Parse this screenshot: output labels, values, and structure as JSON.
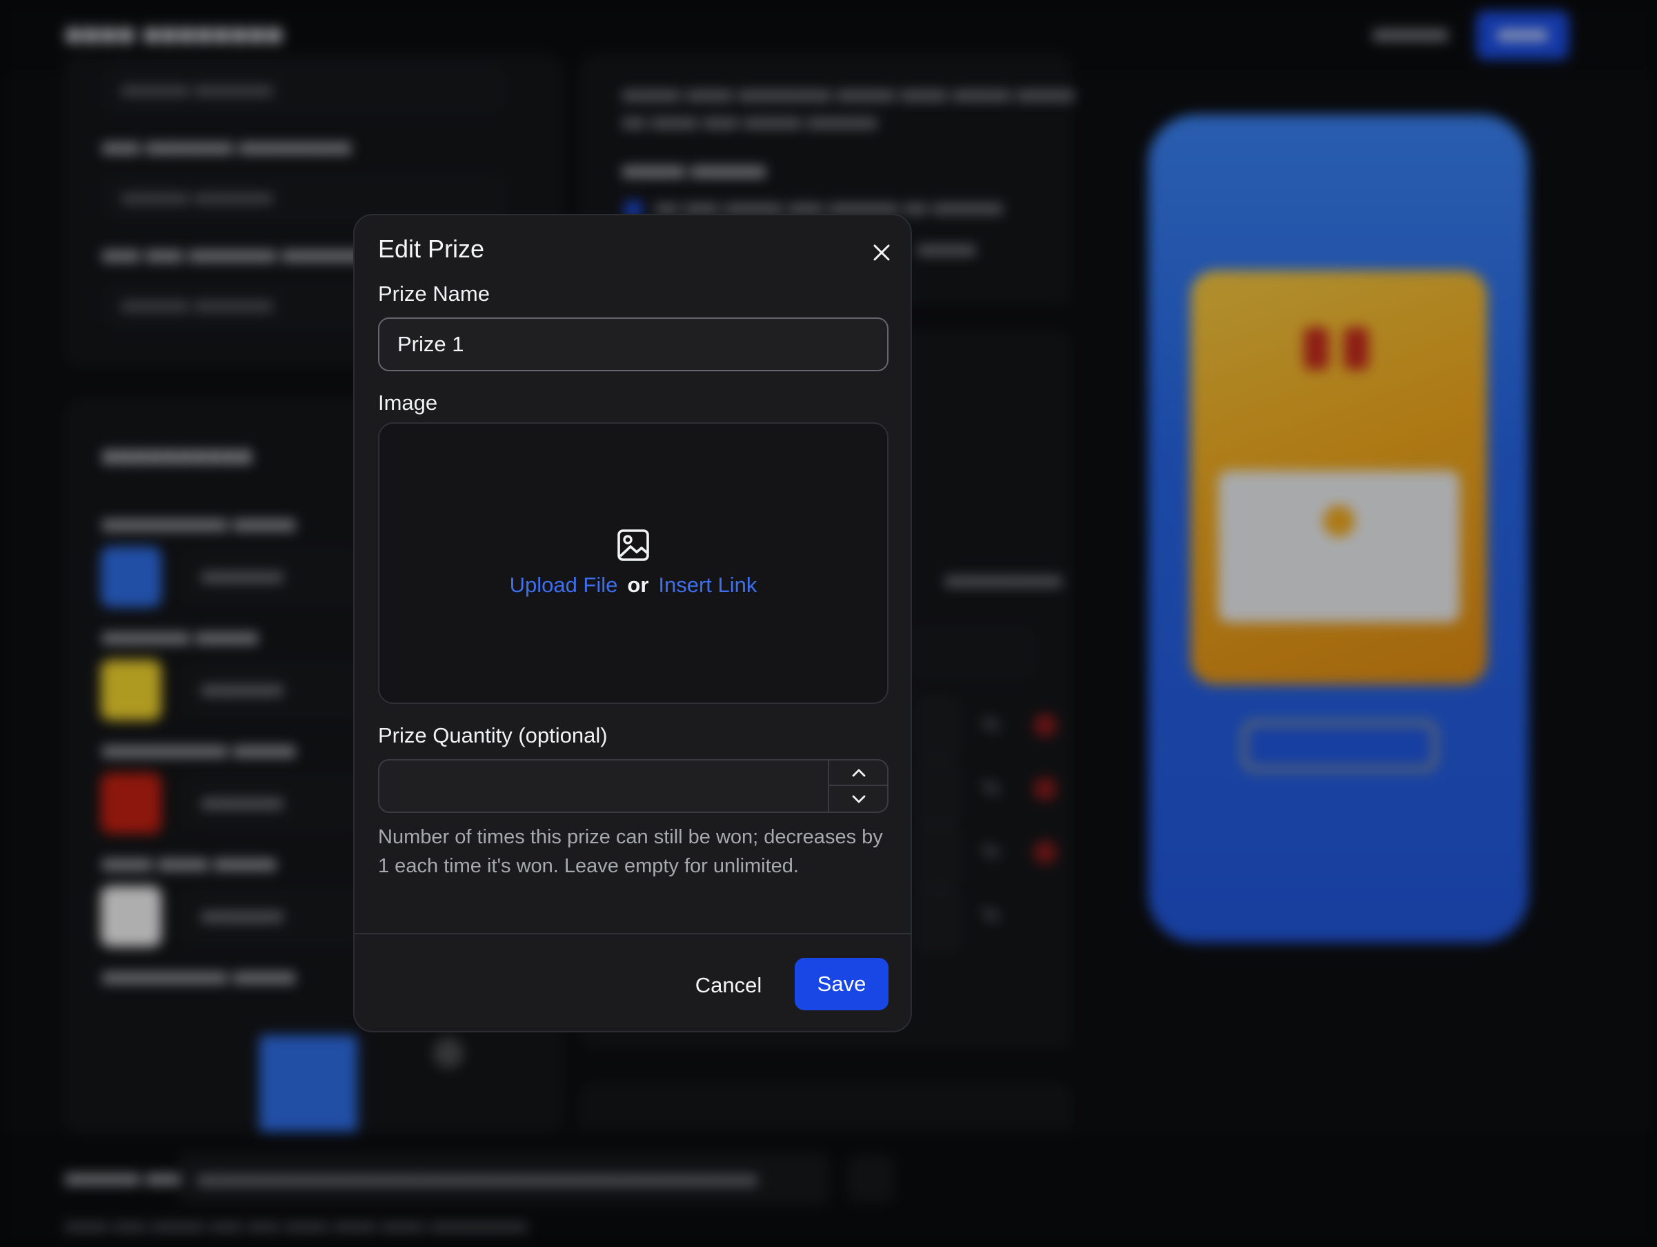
{
  "modal": {
    "title": "Edit Prize",
    "prize_name_label": "Prize Name",
    "prize_name_value": "Prize 1",
    "image_label": "Image",
    "upload_file_label": "Upload File",
    "or_label": "or",
    "insert_link_label": "Insert Link",
    "quantity_label": "Prize Quantity (optional)",
    "quantity_value": "",
    "quantity_help": "Number of times this prize can still be won; decreases by 1 each time it's won. Leave empty for unlimited.",
    "cancel_label": "Cancel",
    "save_label": "Save"
  },
  "colors": {
    "accent": "#1947e5",
    "link": "#3d6ff0",
    "modal_bg": "#1b1b1e",
    "swatch_background": "#2f6ee6",
    "swatch_machine": "#f2d42e",
    "swatch_decorative": "#c42012",
    "swatch_button_text": "#f2f2f2",
    "phone_preview": "#2766e4"
  },
  "icons": {
    "close": "close-icon",
    "image": "image-icon",
    "increment": "chevron-up-icon",
    "decrement": "chevron-down-icon"
  }
}
